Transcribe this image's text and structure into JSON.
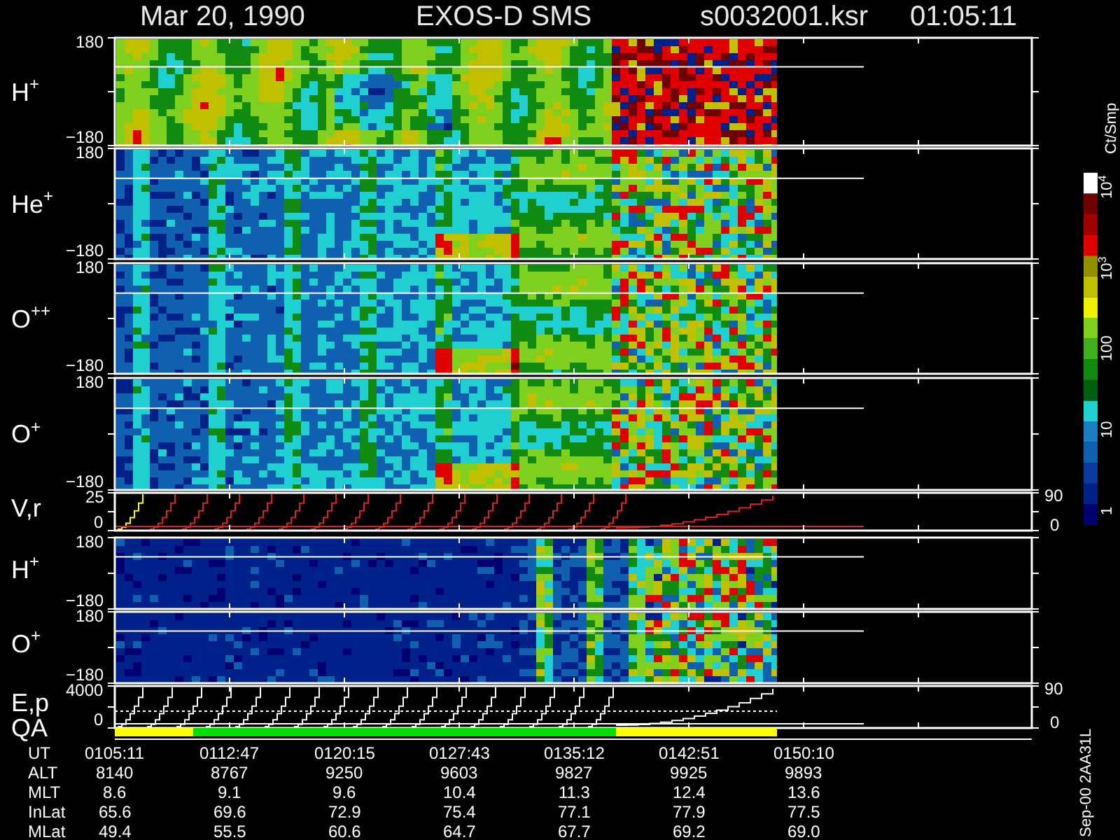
{
  "header": {
    "date": "Mar 20, 1990",
    "mission": "EXOS-D SMS",
    "file": "s0032001.ksr",
    "time": "01:05:11"
  },
  "panels": [
    {
      "kind": "spectrogram",
      "label": "H$^{+}$",
      "left_ticks": [
        "180",
        "−180"
      ]
    },
    {
      "kind": "spectrogram",
      "label": "He$^{+}$",
      "left_ticks": [
        "180",
        "−180"
      ]
    },
    {
      "kind": "spectrogram",
      "label": "O$^{++}$",
      "left_ticks": [
        "180",
        "−180"
      ]
    },
    {
      "kind": "spectrogram",
      "label": "O$^{+}$",
      "left_ticks": [
        "180",
        "−180"
      ]
    },
    {
      "kind": "velocity",
      "label": "V,r",
      "left_ticks": [
        "25",
        "0"
      ],
      "right_ticks": [
        "90",
        "0"
      ]
    },
    {
      "kind": "spectrogram",
      "label": "H$^{+}$",
      "left_ticks": [
        "180",
        "−180"
      ]
    },
    {
      "kind": "spectrogram",
      "label": "O$^{+}$",
      "left_ticks": [
        "180",
        "−180"
      ]
    },
    {
      "kind": "energy",
      "label": "E,p",
      "left_ticks": [
        "4000",
        "0"
      ],
      "right_ticks": [
        "90",
        "0"
      ]
    }
  ],
  "qa": {
    "label": "QA",
    "segments": [
      {
        "color": "#ffff00"
      },
      {
        "color": "#00e000"
      },
      {
        "color": "#ffff00"
      }
    ]
  },
  "color_scale": {
    "title": "Ct/Smp",
    "ticks": [
      "10$^{4}$",
      "10$^{3}$",
      "100",
      "10",
      "1"
    ]
  },
  "table": [
    {
      "label": "UT",
      "values": [
        "0105:11",
        "0112:47",
        "0120:15",
        "0127:43",
        "0135:12",
        "0142:51",
        "0150:10"
      ]
    },
    {
      "label": "ALT",
      "values": [
        "8140",
        "8767",
        "9250",
        "9603",
        "9827",
        "9925",
        "9893"
      ]
    },
    {
      "label": "MLT",
      "values": [
        "8.6",
        "9.1",
        "9.6",
        "10.4",
        "11.3",
        "12.4",
        "13.6"
      ]
    },
    {
      "label": "InLat",
      "values": [
        "65.6",
        "69.6",
        "72.9",
        "75.4",
        "77.1",
        "77.9",
        "77.5"
      ]
    },
    {
      "label": "MLat",
      "values": [
        "49.4",
        "55.5",
        "60.6",
        "64.7",
        "67.7",
        "69.2",
        "69.0"
      ]
    }
  ],
  "footer": "Sep-00 2AA31L"
}
